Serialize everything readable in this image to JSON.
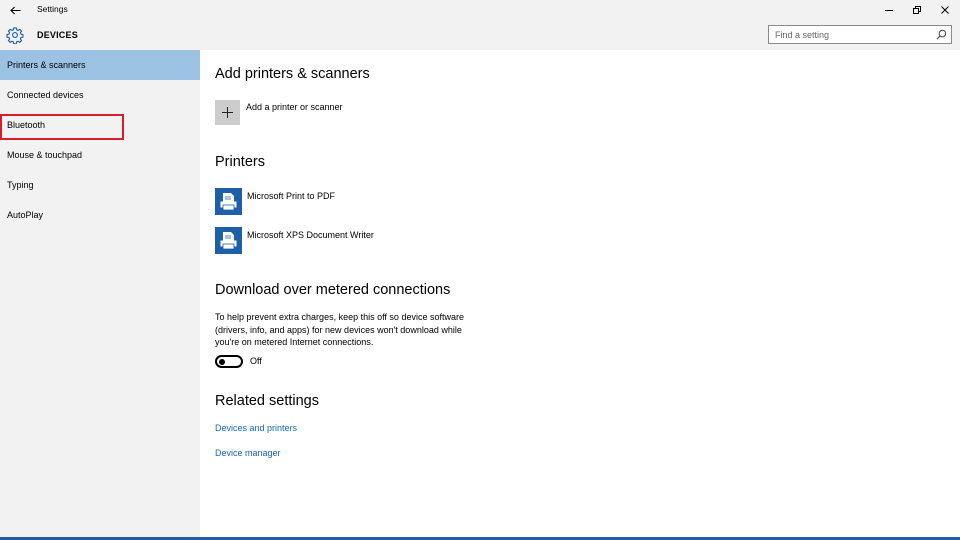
{
  "window": {
    "title": "Settings"
  },
  "header": {
    "section": "DEVICES",
    "search_placeholder": "Find a setting"
  },
  "sidebar": {
    "items": [
      {
        "label": "Printers & scanners",
        "selected": true
      },
      {
        "label": "Connected devices"
      },
      {
        "label": "Bluetooth",
        "highlighted": true
      },
      {
        "label": "Mouse & touchpad"
      },
      {
        "label": "Typing"
      },
      {
        "label": "AutoPlay"
      }
    ]
  },
  "main": {
    "add_section": {
      "heading": "Add printers & scanners",
      "add_label": "Add a printer or scanner"
    },
    "printers": {
      "heading": "Printers",
      "items": [
        {
          "label": "Microsoft Print to PDF"
        },
        {
          "label": "Microsoft XPS Document Writer"
        }
      ]
    },
    "download": {
      "heading": "Download over metered connections",
      "description": "To help prevent extra charges, keep this off so device software (drivers, info, and apps) for new devices won't download while you're on metered Internet connections.",
      "toggle_state": "Off"
    },
    "related": {
      "heading": "Related settings",
      "links": [
        {
          "label": "Devices and printers"
        },
        {
          "label": "Device manager"
        }
      ]
    }
  },
  "colors": {
    "accent": "#9cc2e3",
    "link": "#1466b8",
    "highlight_border": "#d51f2c",
    "printer_tile": "#1e5fa8"
  }
}
